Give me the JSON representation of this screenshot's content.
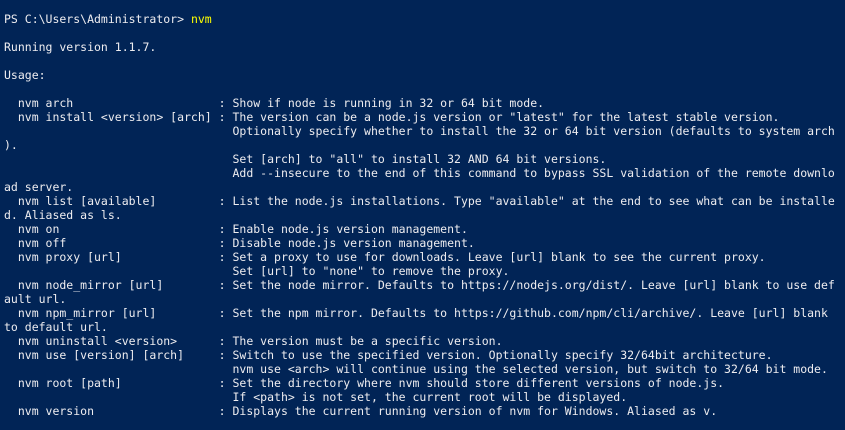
{
  "window": {
    "colors": {
      "background": "#012456",
      "foreground": "#eeedf0",
      "command": "#ffff00"
    }
  },
  "prompt": {
    "path": "PS C:\\Users\\Administrator> ",
    "command": "nvm"
  },
  "output": {
    "lines": [
      "",
      "Running version 1.1.7.",
      "",
      "Usage:",
      "",
      "  nvm arch                     : Show if node is running in 32 or 64 bit mode.",
      "  nvm install <version> [arch] : The version can be a node.js version or \"latest\" for the latest stable version.",
      "                                 Optionally specify whether to install the 32 or 64 bit version (defaults to system arch",
      ").",
      "                                 Set [arch] to \"all\" to install 32 AND 64 bit versions.",
      "                                 Add --insecure to the end of this command to bypass SSL validation of the remote downlo",
      "ad server.",
      "  nvm list [available]         : List the node.js installations. Type \"available\" at the end to see what can be installe",
      "d. Aliased as ls.",
      "  nvm on                       : Enable node.js version management.",
      "  nvm off                      : Disable node.js version management.",
      "  nvm proxy [url]              : Set a proxy to use for downloads. Leave [url] blank to see the current proxy.",
      "                                 Set [url] to \"none\" to remove the proxy.",
      "  nvm node_mirror [url]        : Set the node mirror. Defaults to https://nodejs.org/dist/. Leave [url] blank to use def",
      "ault url.",
      "  nvm npm_mirror [url]         : Set the npm mirror. Defaults to https://github.com/npm/cli/archive/. Leave [url] blank",
      "to default url.",
      "  nvm uninstall <version>      : The version must be a specific version.",
      "  nvm use [version] [arch]     : Switch to use the specified version. Optionally specify 32/64bit architecture.",
      "                                 nvm use <arch> will continue using the selected version, but switch to 32/64 bit mode.",
      "  nvm root [path]              : Set the directory where nvm should store different versions of node.js.",
      "                                 If <path> is not set, the current root will be displayed.",
      "  nvm version                  : Displays the current running version of nvm for Windows. Aliased as v."
    ]
  }
}
